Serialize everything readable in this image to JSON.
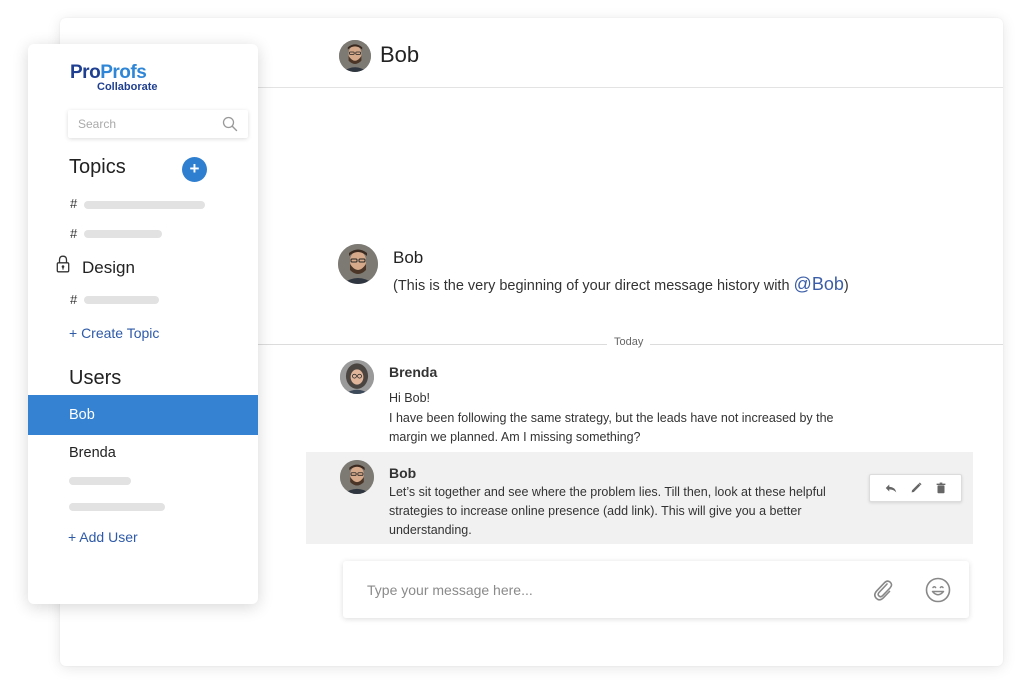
{
  "sidebar": {
    "logo": {
      "brand_part1": "Pro",
      "brand_part2": "Profs",
      "sub": "Collaborate"
    },
    "search": {
      "placeholder": "Search"
    },
    "topics_title": "Topics",
    "add_topic_symbol": "+",
    "topics": [
      {
        "prefix": "#"
      },
      {
        "prefix": "#"
      }
    ],
    "private_topic": {
      "name": "Design",
      "icon": "lock-icon"
    },
    "private_subtopic": {
      "prefix": "#"
    },
    "create_topic": "+ Create Topic",
    "users_title": "Users",
    "users": [
      {
        "name": "Bob",
        "active": true
      },
      {
        "name": "Brenda",
        "active": false
      }
    ],
    "add_user": "+ Add User"
  },
  "chat": {
    "header_title": "Bob",
    "intro": {
      "name": "Bob",
      "text_prefix": "(This is the very beginning of your direct message history with ",
      "mention": "@Bob",
      "text_suffix": ")"
    },
    "divider_label": "Today",
    "messages": [
      {
        "author": "Brenda",
        "lines": [
          "Hi Bob!",
          "I have been following the same strategy, but the leads have not increased by the",
          "margin we planned. Am I missing something?"
        ]
      },
      {
        "author": "Bob",
        "lines": [
          "Let’s sit together and see where the problem lies. Till then, look at these helpful",
          "strategies to increase online presence (add link). This will give you a better",
          "understanding."
        ]
      }
    ],
    "message_actions": [
      "reply-icon",
      "edit-icon",
      "delete-icon"
    ],
    "composer": {
      "placeholder": "Type your message here..."
    }
  },
  "colors": {
    "accent": "#3582d2",
    "link": "#2e5aa8",
    "brand_dark": "#1f3f91",
    "brand_light": "#2f86d6"
  }
}
